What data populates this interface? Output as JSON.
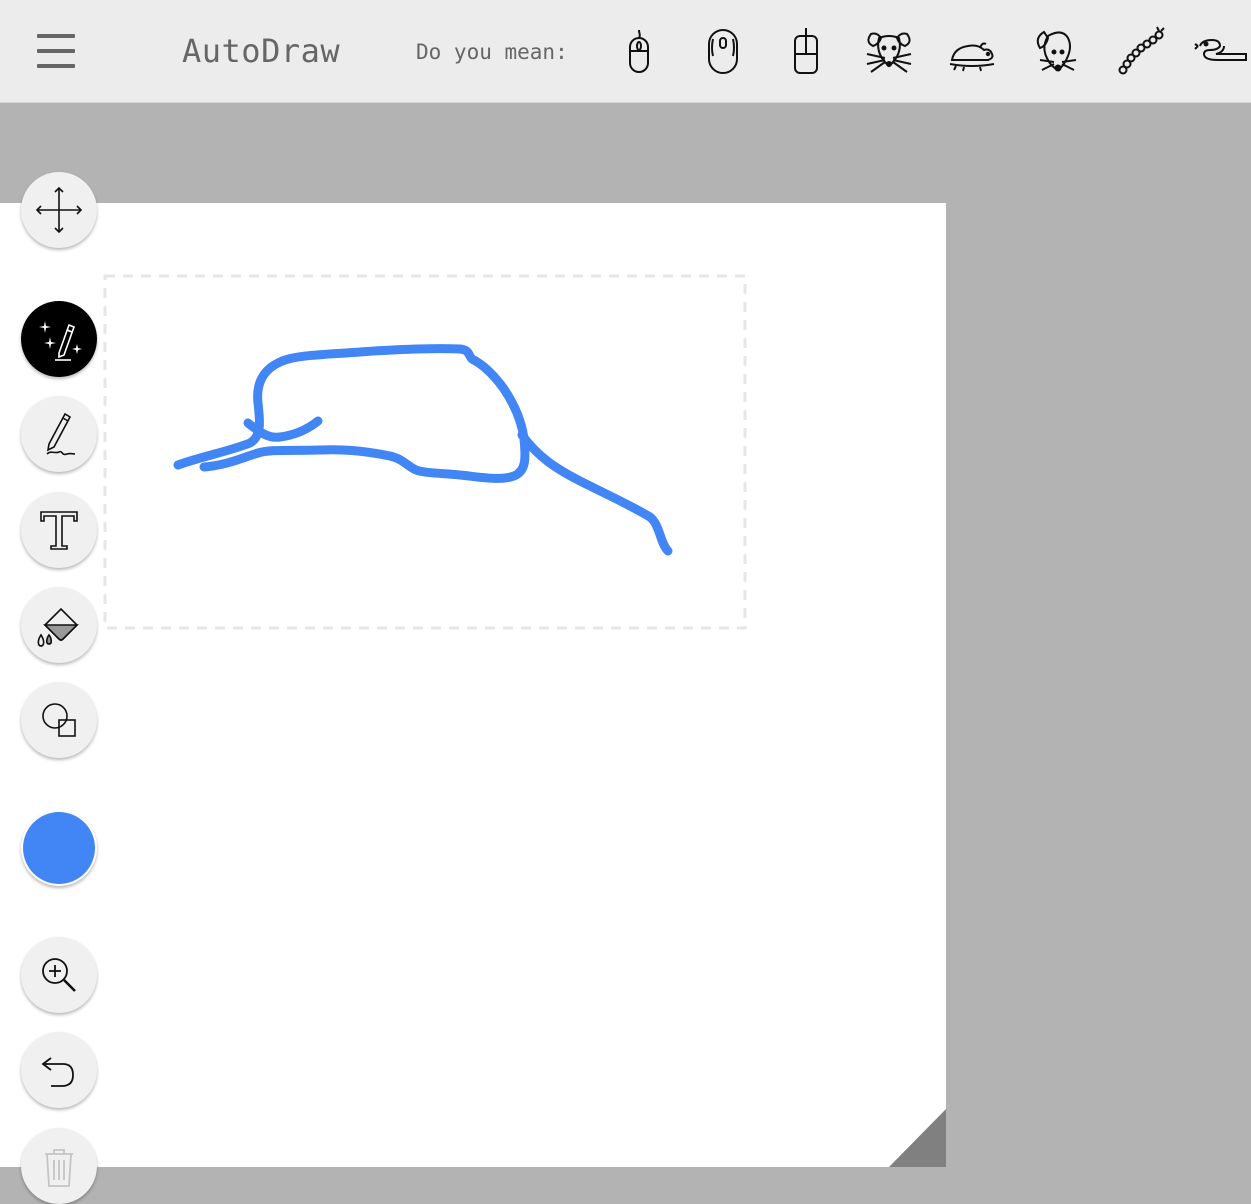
{
  "header": {
    "title": "AutoDraw",
    "suggestion_label": "Do you mean:",
    "menu_icon": "hamburger-menu-icon"
  },
  "suggestions": [
    {
      "icon": "computer-mouse-icon"
    },
    {
      "icon": "computer-mouse-wheel-icon"
    },
    {
      "icon": "computer-mouse-cable-icon"
    },
    {
      "icon": "rat-face-icon"
    },
    {
      "icon": "mouse-animal-icon"
    },
    {
      "icon": "mouse-head-icon"
    },
    {
      "icon": "caterpillar-icon"
    },
    {
      "icon": "snake-icon"
    }
  ],
  "toolbar": {
    "tools": [
      {
        "name": "move-tool",
        "icon": "move-arrows-icon",
        "active": false
      },
      {
        "name": "autodraw-tool",
        "icon": "autodraw-sparkle-pencil-icon",
        "active": true
      },
      {
        "name": "draw-tool",
        "icon": "pencil-icon",
        "active": false
      },
      {
        "name": "type-tool",
        "icon": "text-t-icon",
        "active": false
      },
      {
        "name": "fill-tool",
        "icon": "paint-bucket-icon",
        "active": false
      },
      {
        "name": "shape-tool",
        "icon": "shapes-icon",
        "active": false
      }
    ],
    "color": "#4285f4",
    "actions": [
      {
        "name": "zoom-tool",
        "icon": "zoom-in-icon"
      },
      {
        "name": "undo-button",
        "icon": "undo-icon"
      },
      {
        "name": "delete-button",
        "icon": "trash-icon",
        "disabled": true
      }
    ]
  },
  "canvas": {
    "stroke_color": "#4285f4",
    "selection_border": "#e6e6e6",
    "background": "#ffffff",
    "corner_color": "#808080"
  }
}
